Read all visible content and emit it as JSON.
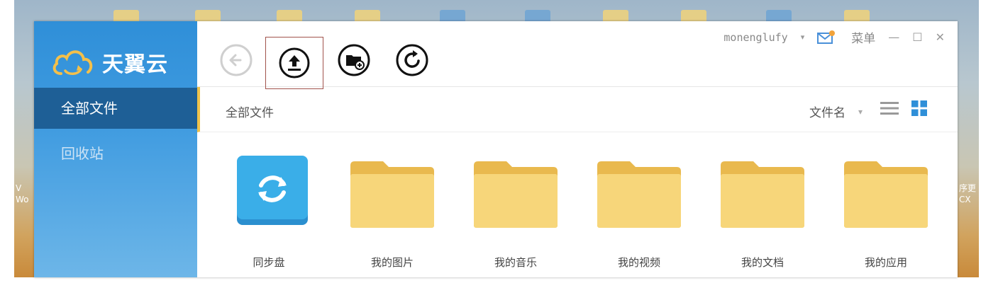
{
  "app": {
    "logo_text": "天翼云",
    "username": "monenglufy",
    "menu_label": "菜单",
    "minimize_glyph": "—",
    "maximize_glyph": "☐",
    "close_glyph": "✕"
  },
  "sidebar": {
    "items": [
      {
        "label": "全部文件",
        "active": true
      },
      {
        "label": "回收站",
        "active": false
      }
    ]
  },
  "toolbar": {
    "buttons": [
      {
        "icon": "back-arrow-icon",
        "enabled": false
      },
      {
        "icon": "upload-icon",
        "selected": true
      },
      {
        "icon": "new-folder-icon"
      },
      {
        "icon": "refresh-icon"
      }
    ]
  },
  "pathbar": {
    "breadcrumb": "全部文件",
    "sort_label": "文件名",
    "sort_arrow": "▾"
  },
  "files": [
    {
      "name": "同步盘",
      "type": "sync"
    },
    {
      "name": "我的图片",
      "type": "folder"
    },
    {
      "name": "我的音乐",
      "type": "folder"
    },
    {
      "name": "我的视频",
      "type": "folder"
    },
    {
      "name": "我的文档",
      "type": "folder"
    },
    {
      "name": "我的应用",
      "type": "folder"
    }
  ],
  "colors": {
    "sidebar_blue": "#3f9be0",
    "active_nav": "#1e5f96",
    "folder_yellow": "#f7d67a",
    "sync_blue": "#3aaee8",
    "accent_bar": "#f0c24a",
    "selection_frame": "#a0524b",
    "grid_view_blue": "#2f8fd8"
  },
  "desktop": {
    "left_text": "V\nWo",
    "right_text": "序更\nCX"
  }
}
